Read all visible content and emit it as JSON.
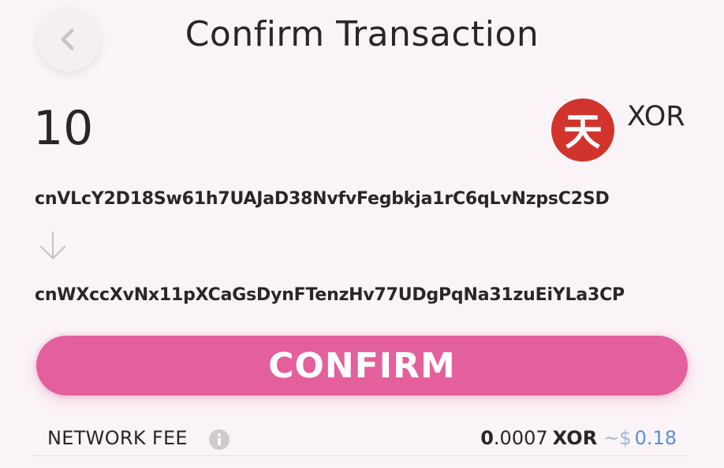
{
  "header": {
    "title": "Confirm Transaction"
  },
  "transaction": {
    "amount": "10",
    "token_symbol": "XOR",
    "token_icon": "sora-xor-logo",
    "from_address": "cnVLcY2D18Sw61h7UAJaD38NvfvFegbkja1rC6qLvNzpsC2SD",
    "to_address": "cnWXccXvNx11pXCaGsDynFTenzHv77UDgPqNa31zuEiYLa3CP"
  },
  "actions": {
    "confirm_label": "CONFIRM"
  },
  "fee": {
    "label": "NETWORK FEE",
    "value_int": "0",
    "value_dec": ".0007",
    "symbol": "XOR",
    "usd_prefix": "~$",
    "usd_value": "0.18"
  },
  "colors": {
    "accent": "#e4609d",
    "token_red": "#d0342c",
    "usd_blue": "#5b8fd6",
    "background": "#faf4f8"
  }
}
